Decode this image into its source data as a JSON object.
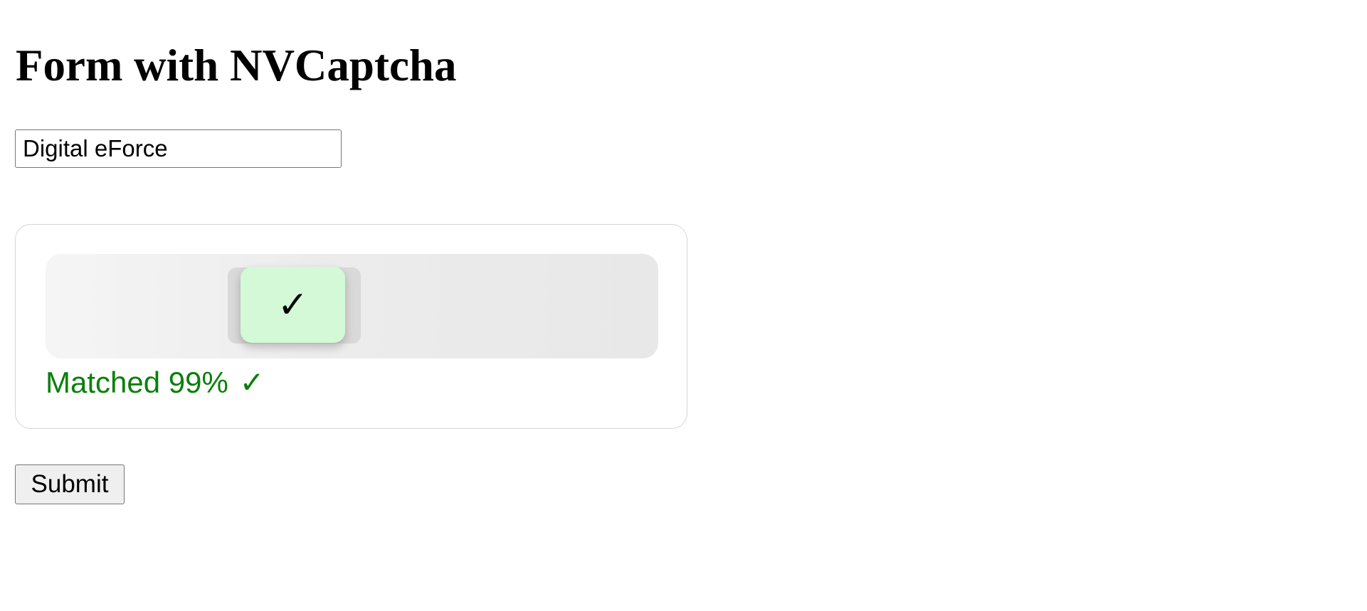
{
  "page": {
    "title": "Form with NVCaptcha"
  },
  "form": {
    "name_input": {
      "value": "Digital eForce",
      "placeholder": ""
    },
    "submit_label": "Submit"
  },
  "captcha": {
    "handle_icon": "checkmark-icon",
    "handle_glyph": "✓",
    "status_text": "Matched 99%",
    "status_icon": "checkmark-icon",
    "status_glyph": "✓",
    "match_percent": 99,
    "colors": {
      "status_green": "#0a7f0a",
      "handle_bg": "#d3f9d6",
      "track_bg": "#ececec",
      "slot_bg": "#d9d9d9"
    }
  }
}
